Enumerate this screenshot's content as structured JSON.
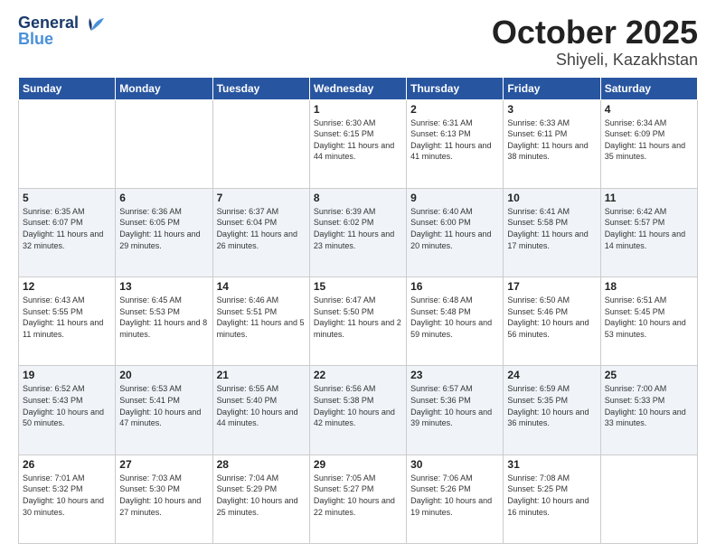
{
  "header": {
    "logo_line1": "General",
    "logo_line2": "Blue",
    "month": "October 2025",
    "location": "Shiyeli, Kazakhstan"
  },
  "days_of_week": [
    "Sunday",
    "Monday",
    "Tuesday",
    "Wednesday",
    "Thursday",
    "Friday",
    "Saturday"
  ],
  "weeks": [
    [
      {
        "day": "",
        "info": ""
      },
      {
        "day": "",
        "info": ""
      },
      {
        "day": "",
        "info": ""
      },
      {
        "day": "1",
        "info": "Sunrise: 6:30 AM\nSunset: 6:15 PM\nDaylight: 11 hours and 44 minutes."
      },
      {
        "day": "2",
        "info": "Sunrise: 6:31 AM\nSunset: 6:13 PM\nDaylight: 11 hours and 41 minutes."
      },
      {
        "day": "3",
        "info": "Sunrise: 6:33 AM\nSunset: 6:11 PM\nDaylight: 11 hours and 38 minutes."
      },
      {
        "day": "4",
        "info": "Sunrise: 6:34 AM\nSunset: 6:09 PM\nDaylight: 11 hours and 35 minutes."
      }
    ],
    [
      {
        "day": "5",
        "info": "Sunrise: 6:35 AM\nSunset: 6:07 PM\nDaylight: 11 hours and 32 minutes."
      },
      {
        "day": "6",
        "info": "Sunrise: 6:36 AM\nSunset: 6:05 PM\nDaylight: 11 hours and 29 minutes."
      },
      {
        "day": "7",
        "info": "Sunrise: 6:37 AM\nSunset: 6:04 PM\nDaylight: 11 hours and 26 minutes."
      },
      {
        "day": "8",
        "info": "Sunrise: 6:39 AM\nSunset: 6:02 PM\nDaylight: 11 hours and 23 minutes."
      },
      {
        "day": "9",
        "info": "Sunrise: 6:40 AM\nSunset: 6:00 PM\nDaylight: 11 hours and 20 minutes."
      },
      {
        "day": "10",
        "info": "Sunrise: 6:41 AM\nSunset: 5:58 PM\nDaylight: 11 hours and 17 minutes."
      },
      {
        "day": "11",
        "info": "Sunrise: 6:42 AM\nSunset: 5:57 PM\nDaylight: 11 hours and 14 minutes."
      }
    ],
    [
      {
        "day": "12",
        "info": "Sunrise: 6:43 AM\nSunset: 5:55 PM\nDaylight: 11 hours and 11 minutes."
      },
      {
        "day": "13",
        "info": "Sunrise: 6:45 AM\nSunset: 5:53 PM\nDaylight: 11 hours and 8 minutes."
      },
      {
        "day": "14",
        "info": "Sunrise: 6:46 AM\nSunset: 5:51 PM\nDaylight: 11 hours and 5 minutes."
      },
      {
        "day": "15",
        "info": "Sunrise: 6:47 AM\nSunset: 5:50 PM\nDaylight: 11 hours and 2 minutes."
      },
      {
        "day": "16",
        "info": "Sunrise: 6:48 AM\nSunset: 5:48 PM\nDaylight: 10 hours and 59 minutes."
      },
      {
        "day": "17",
        "info": "Sunrise: 6:50 AM\nSunset: 5:46 PM\nDaylight: 10 hours and 56 minutes."
      },
      {
        "day": "18",
        "info": "Sunrise: 6:51 AM\nSunset: 5:45 PM\nDaylight: 10 hours and 53 minutes."
      }
    ],
    [
      {
        "day": "19",
        "info": "Sunrise: 6:52 AM\nSunset: 5:43 PM\nDaylight: 10 hours and 50 minutes."
      },
      {
        "day": "20",
        "info": "Sunrise: 6:53 AM\nSunset: 5:41 PM\nDaylight: 10 hours and 47 minutes."
      },
      {
        "day": "21",
        "info": "Sunrise: 6:55 AM\nSunset: 5:40 PM\nDaylight: 10 hours and 44 minutes."
      },
      {
        "day": "22",
        "info": "Sunrise: 6:56 AM\nSunset: 5:38 PM\nDaylight: 10 hours and 42 minutes."
      },
      {
        "day": "23",
        "info": "Sunrise: 6:57 AM\nSunset: 5:36 PM\nDaylight: 10 hours and 39 minutes."
      },
      {
        "day": "24",
        "info": "Sunrise: 6:59 AM\nSunset: 5:35 PM\nDaylight: 10 hours and 36 minutes."
      },
      {
        "day": "25",
        "info": "Sunrise: 7:00 AM\nSunset: 5:33 PM\nDaylight: 10 hours and 33 minutes."
      }
    ],
    [
      {
        "day": "26",
        "info": "Sunrise: 7:01 AM\nSunset: 5:32 PM\nDaylight: 10 hours and 30 minutes."
      },
      {
        "day": "27",
        "info": "Sunrise: 7:03 AM\nSunset: 5:30 PM\nDaylight: 10 hours and 27 minutes."
      },
      {
        "day": "28",
        "info": "Sunrise: 7:04 AM\nSunset: 5:29 PM\nDaylight: 10 hours and 25 minutes."
      },
      {
        "day": "29",
        "info": "Sunrise: 7:05 AM\nSunset: 5:27 PM\nDaylight: 10 hours and 22 minutes."
      },
      {
        "day": "30",
        "info": "Sunrise: 7:06 AM\nSunset: 5:26 PM\nDaylight: 10 hours and 19 minutes."
      },
      {
        "day": "31",
        "info": "Sunrise: 7:08 AM\nSunset: 5:25 PM\nDaylight: 10 hours and 16 minutes."
      },
      {
        "day": "",
        "info": ""
      }
    ]
  ]
}
